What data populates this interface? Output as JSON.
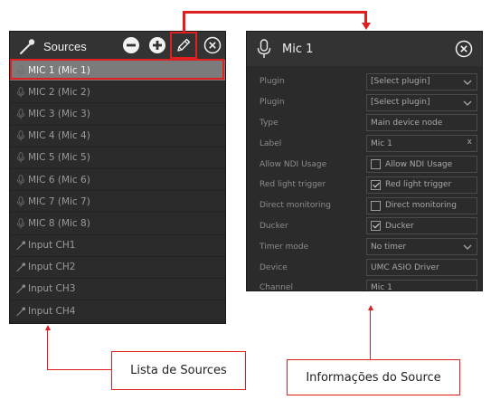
{
  "sources_panel": {
    "title": "Sources",
    "items": [
      {
        "label": "MIC 1 (Mic 1)",
        "icon": "mic-icon",
        "selected": true
      },
      {
        "label": "MIC 2 (Mic 2)",
        "icon": "mic-icon"
      },
      {
        "label": "MIC 3 (Mic 3)",
        "icon": "mic-icon"
      },
      {
        "label": "MIC 4 (Mic 4)",
        "icon": "mic-icon"
      },
      {
        "label": "MIC 5 (Mic 5)",
        "icon": "mic-icon"
      },
      {
        "label": "MIC 6 (Mic 6)",
        "icon": "mic-icon"
      },
      {
        "label": "MIC 7 (Mic 7)",
        "icon": "mic-icon"
      },
      {
        "label": "MIC 8 (Mic 8)",
        "icon": "mic-icon"
      },
      {
        "label": "Input CH1",
        "icon": "line-input-icon"
      },
      {
        "label": "Input CH2",
        "icon": "line-input-icon"
      },
      {
        "label": "Input CH3",
        "icon": "line-input-icon"
      },
      {
        "label": "Input CH4",
        "icon": "line-input-icon"
      }
    ]
  },
  "info_panel": {
    "title": "Mic 1",
    "rows": [
      {
        "label": "Plugin",
        "value": "[Select plugin]",
        "kind": "dropdown"
      },
      {
        "label": "Plugin",
        "value": "[Select plugin]",
        "kind": "dropdown"
      },
      {
        "label": "Type",
        "value": "Main device node",
        "kind": "readonly"
      },
      {
        "label": "Label",
        "value": "Mic 1",
        "kind": "text-clear",
        "clear": "x"
      },
      {
        "label": "Allow NDI Usage",
        "value": "Allow NDI Usage",
        "kind": "checkbox",
        "checked": false
      },
      {
        "label": "Red light trigger",
        "value": "Red light trigger",
        "kind": "checkbox",
        "checked": true
      },
      {
        "label": "Direct monitoring",
        "value": "Direct monitoring",
        "kind": "checkbox",
        "checked": false
      },
      {
        "label": "Ducker",
        "value": "Ducker",
        "kind": "checkbox",
        "checked": true
      },
      {
        "label": "Timer mode",
        "value": "No timer",
        "kind": "dropdown"
      },
      {
        "label": "Device",
        "value": "UMC ASIO Driver",
        "kind": "readonly"
      },
      {
        "label": "Channel",
        "value": "Mic 1",
        "kind": "readonly"
      }
    ]
  },
  "annotations": {
    "sources_caption": "Lista de Sources",
    "info_caption": "Informações do Source"
  },
  "colors": {
    "panel_bg": "#2b2b2b",
    "header_bg": "#333333",
    "selected_bg": "#7b7b7b",
    "annotation_red": "#e02020"
  }
}
